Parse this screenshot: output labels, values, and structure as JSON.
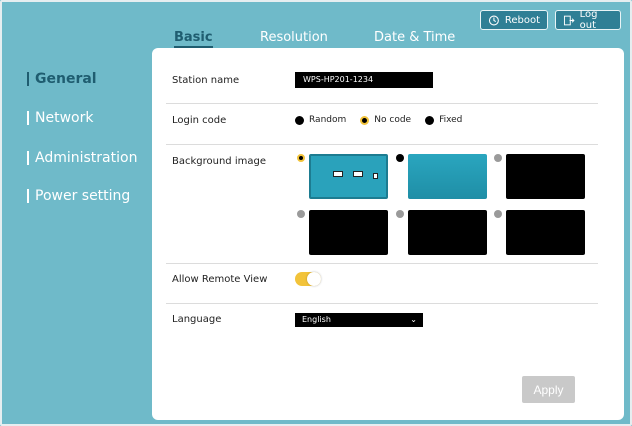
{
  "header": {
    "reboot_label": "Reboot",
    "logout_label": "Log out"
  },
  "tabs": [
    {
      "label": "Basic",
      "active": true
    },
    {
      "label": "Resolution",
      "active": false
    },
    {
      "label": "Date & Time",
      "active": false
    }
  ],
  "sidebar": {
    "items": [
      {
        "label": "General",
        "active": true
      },
      {
        "label": "Network",
        "active": false
      },
      {
        "label": "Administration",
        "active": false
      },
      {
        "label": "Power setting",
        "active": false
      }
    ]
  },
  "form": {
    "station_name": {
      "label": "Station name",
      "value": "WPS-HP201-1234"
    },
    "login_code": {
      "label": "Login code",
      "options": [
        "Random",
        "No code",
        "Fixed"
      ],
      "selected": "No code"
    },
    "background_image": {
      "label": "Background image",
      "selected_index": 0
    },
    "allow_remote_view": {
      "label": "Allow Remote View",
      "enabled": true
    },
    "language": {
      "label": "Language",
      "value": "English"
    },
    "apply_label": "Apply"
  },
  "colors": {
    "background": "#6fbac9",
    "accent": "#1f5d70",
    "toggle_on": "#f2c33a",
    "apply_disabled": "#c9c9c9"
  }
}
